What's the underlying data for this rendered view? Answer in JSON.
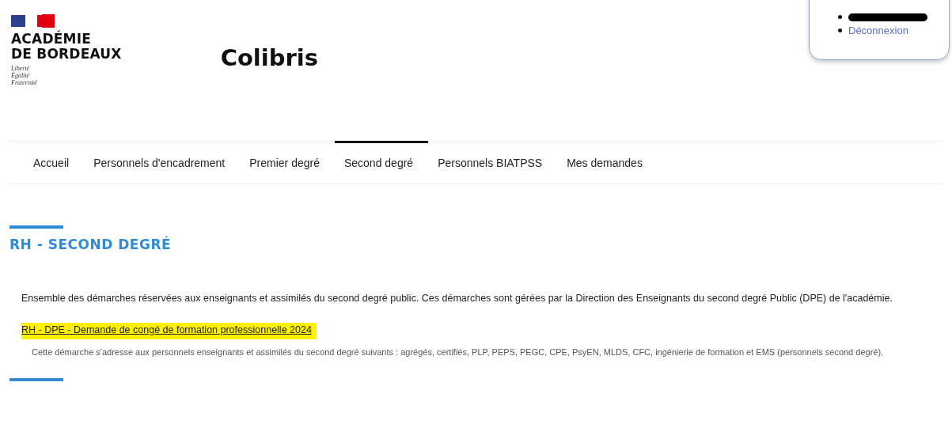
{
  "logo": {
    "lines": [
      "ACADÉMIE",
      "DE BORDEAUX"
    ],
    "motto": [
      "Liberté",
      "Égalité",
      "Fraternité"
    ]
  },
  "site_title": "Colibris",
  "user_menu": {
    "items": [
      {
        "kind": "redacted"
      },
      {
        "kind": "link",
        "label": "Déconnexion"
      }
    ]
  },
  "nav_tabs": [
    {
      "label": "Accueil",
      "selected": false
    },
    {
      "label": "Personnels d'encadrement",
      "selected": false
    },
    {
      "label": "Premier degré",
      "selected": false
    },
    {
      "label": "Second degré",
      "selected": true
    },
    {
      "label": "Personnels BIATPSS",
      "selected": false
    },
    {
      "label": "Mes demandes",
      "selected": false
    }
  ],
  "section": {
    "heading": "RH - SECOND DEGRÉ",
    "intro": "Ensemble des démarches réservées aux enseignants et assimilés du second degré public. Ces démarches sont gérées par la Direction des Enseignants du second degré Public (DPE) de l'académie.",
    "procedures": [
      {
        "title": "RH - DPE - Demande de congé de formation professionnelle 2024",
        "highlighted": true,
        "description": "Cette démarche s'adresse aux personnels enseignants et assimilés du second degré suivants : agrégés, certifiés, PLP, PEPS, PEGC, CPE, PsyEN, MLDS, CFC, ingénierie de formation et EMS (personnels second degré),"
      }
    ]
  },
  "next_section": {
    "kind": "rule"
  }
}
